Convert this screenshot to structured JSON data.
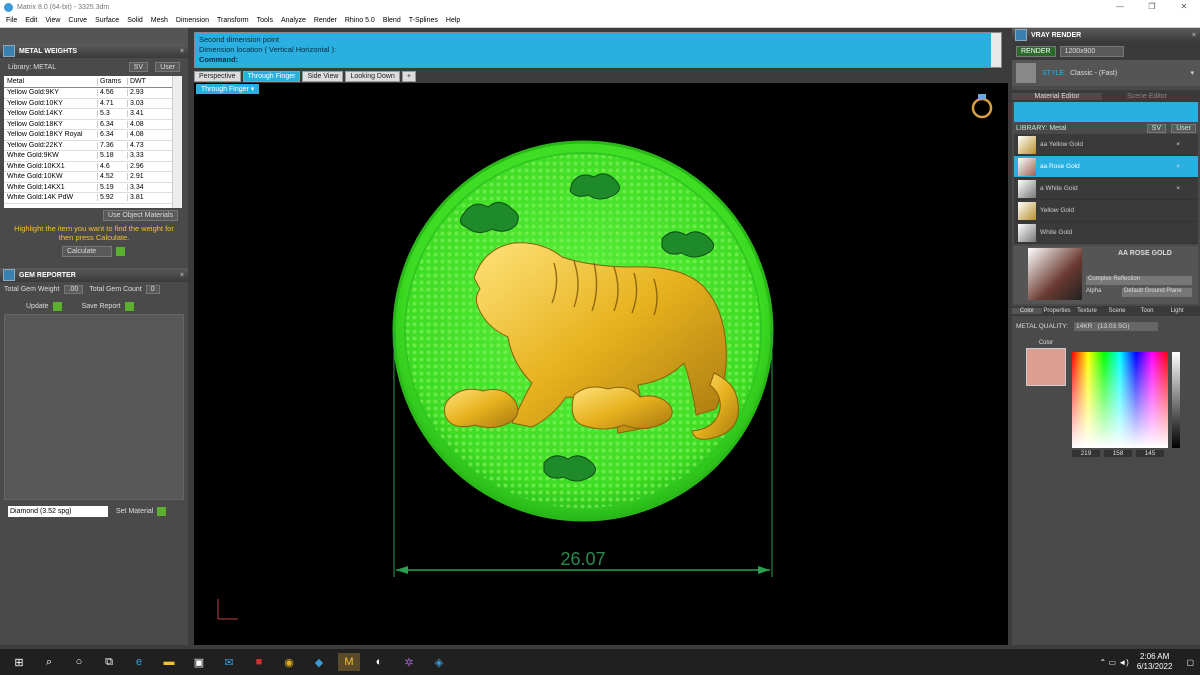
{
  "window": {
    "title": "Matrix 8.0 (64-bit) - 3325.3dm",
    "min": "—",
    "max": "❐",
    "close": "✕"
  },
  "menu": [
    "File",
    "Edit",
    "View",
    "Curve",
    "Surface",
    "Solid",
    "Mesh",
    "Dimension",
    "Transform",
    "Tools",
    "Analyze",
    "Render",
    "Rhino 5.0",
    "Blend",
    "T-Splines",
    "Help"
  ],
  "metal_weights": {
    "title": "METAL WEIGHTS",
    "library_label": "Library: METAL",
    "sv": "SV",
    "user": "User",
    "headers": [
      "Metal",
      "Grams",
      "DWT"
    ],
    "rows": [
      [
        "Yellow Gold:9KY",
        "4.56",
        "2.93"
      ],
      [
        "Yellow Gold:10KY",
        "4.71",
        "3.03"
      ],
      [
        "Yellow Gold:14KY",
        "5.3",
        "3.41"
      ],
      [
        "Yellow Gold:18KY",
        "6.34",
        "4.08"
      ],
      [
        "Yellow Gold:18KY Royal",
        "6.34",
        "4.08"
      ],
      [
        "Yellow Gold:22KY",
        "7.36",
        "4.73"
      ],
      [
        "White Gold:9KW",
        "5.18",
        "3.33"
      ],
      [
        "White Gold:10KX1",
        "4.6",
        "2.96"
      ],
      [
        "White Gold:10KW",
        "4.52",
        "2.91"
      ],
      [
        "White Gold:14KX1",
        "5.19",
        "3.34"
      ],
      [
        "White Gold:14K PdW",
        "5.92",
        "3.81"
      ]
    ],
    "use_object": "Use Object Materials",
    "hint": "Highlight the item you want to find the weight for then press Calculate.",
    "calculate": "Calculate"
  },
  "gem_reporter": {
    "title": "GEM REPORTER",
    "total_weight_label": "Total Gem Weight",
    "total_weight": ".00",
    "total_count_label": "Total Gem Count",
    "total_count": "0",
    "update": "Update",
    "save": "Save Report",
    "diamond": "Diamond    (3.52 spg)",
    "set_material": "Set Material"
  },
  "command": {
    "line1": "Second dimension point",
    "line2": "Dimension location ( Vertical  Horizontal ):",
    "prompt": "Command:"
  },
  "tabs": [
    "Perspective",
    "Through Finger",
    "Side View",
    "Looking Down",
    "+"
  ],
  "viewport": {
    "label": "Through Finger",
    "dimension": "26.07"
  },
  "vray": {
    "title": "VRAY RENDER",
    "render": "RENDER",
    "size": "1200x900",
    "style_label": "STYLE:",
    "style": "Classic - (Fast)",
    "editor_tabs": [
      "Material Editor",
      "Scene Editor"
    ],
    "library": "LIBRARY: Metal",
    "sv": "SV",
    "user": "User",
    "materials": [
      "aa Yellow Gold",
      "aa Rose Gold",
      "a White Gold",
      "Yellow Gold",
      "White Gold"
    ],
    "selected_name": "AA ROSE GOLD",
    "reflection": "Complex Reflection",
    "alpha": "Alpha",
    "ground": "Default Ground Plane",
    "prop_tabs": [
      "Color",
      "Properties",
      "Texture",
      "Scene",
      "Toon",
      "Light"
    ],
    "quality_label": "METAL QUALITY:",
    "quality": "14KR",
    "quality_val": "(13.03 SG)",
    "color_label": "Color",
    "r": "219",
    "g": "158",
    "b": "145",
    "swatch": "#db9e91"
  },
  "taskbar": {
    "time": "2:06 AM",
    "date": "6/13/2022"
  }
}
